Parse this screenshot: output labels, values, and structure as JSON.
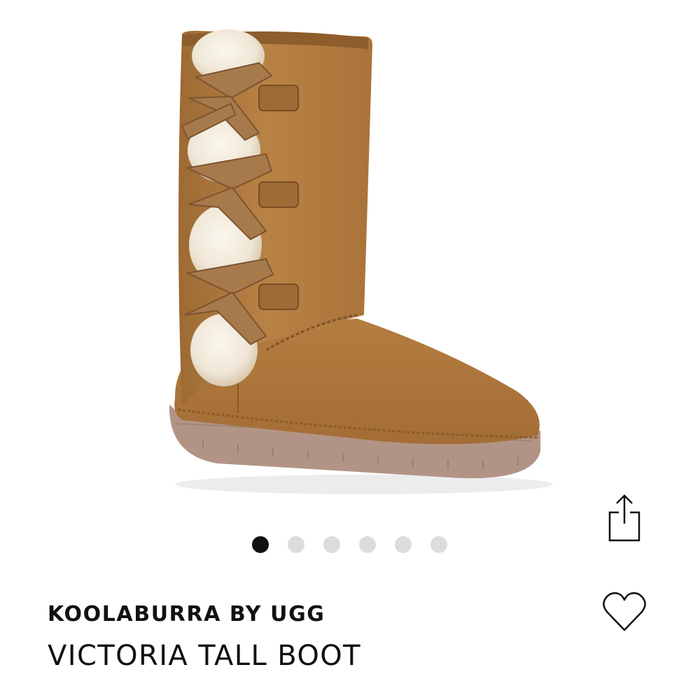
{
  "product": {
    "brand": "KOOLABURRA BY UGG",
    "name": "VICTORIA TALL BOOT"
  },
  "gallery": {
    "image_count": 6,
    "active_index": 0
  },
  "icons": {
    "share": "share-icon",
    "wishlist": "heart-icon"
  },
  "colors": {
    "active_dot": "#111111",
    "inactive_dot": "#dcdcdc",
    "boot_suede": "#b07a3e",
    "sole": "#b29486",
    "fur": "#f2ece1"
  }
}
